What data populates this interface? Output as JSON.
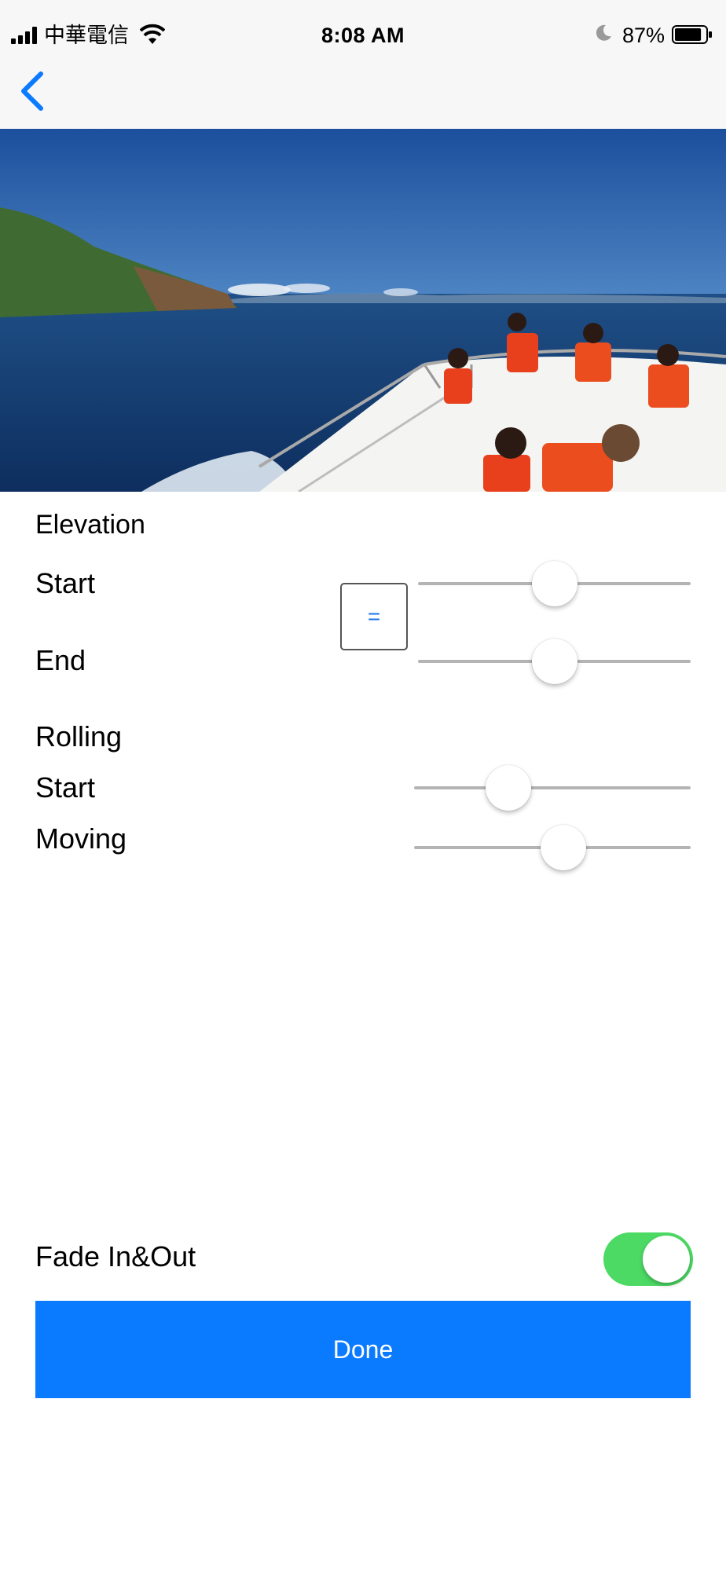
{
  "status_bar": {
    "carrier": "中華電信",
    "time": "8:08 AM",
    "battery_percent": "87%",
    "battery_level": 0.87,
    "icons": [
      "signal-icon",
      "wifi-icon",
      "moon-icon",
      "battery-icon"
    ]
  },
  "nav": {
    "back_icon": "chevron-left-icon"
  },
  "elevation": {
    "title": "Elevation",
    "start_label": "Start",
    "end_label": "End",
    "link_button_label": "=",
    "start_value": 0.5,
    "end_value": 0.5
  },
  "rolling": {
    "title": "Rolling",
    "start_label": "Start",
    "moving_label": "Moving",
    "start_value": 0.34,
    "moving_value": 0.54
  },
  "fade": {
    "label": "Fade In&Out",
    "enabled": true
  },
  "done_label": "Done",
  "colors": {
    "accent": "#0a7aff",
    "toggle_on": "#4cd964",
    "nav_bar": "#f7f7f7"
  }
}
